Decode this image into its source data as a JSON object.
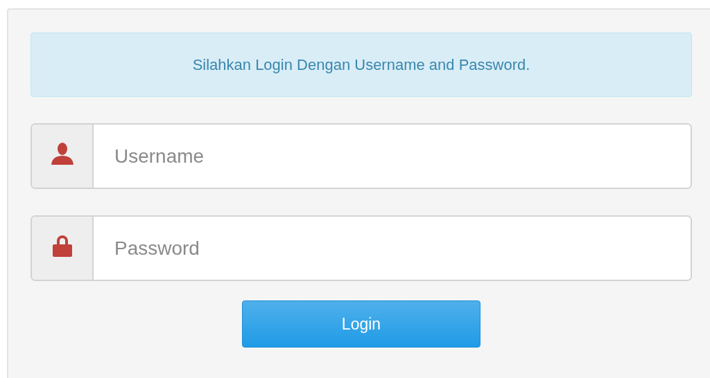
{
  "alert": {
    "text": "Silahkan Login Dengan Username and Password."
  },
  "fields": [
    {
      "kind": "user",
      "placeholder": "Username"
    },
    {
      "kind": "lock",
      "placeholder": "Password"
    }
  ],
  "button": {
    "label": "Login"
  }
}
